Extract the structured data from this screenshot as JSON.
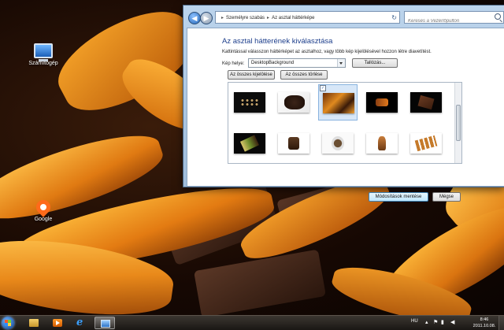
{
  "desktop": {
    "icons": [
      {
        "label": "Számítógép",
        "icon": "computer-icon"
      },
      {
        "label": "Google",
        "icon": "map-pin-icon"
      }
    ]
  },
  "window": {
    "breadcrumb": [
      "Személyre szabás",
      "Az asztal háttérképe"
    ],
    "search_placeholder": "Keresés a Vezérlőpulton",
    "title": "Az asztal hátterének kiválasztása",
    "description": "Kattintással válasszon háttérképet az asztalhoz, vagy több kép kijelölésével hozzon létre diavetítést.",
    "location_label": "Kép helye:",
    "location_value": "DesktopBackground",
    "browse_label": "Tallózás...",
    "select_all_label": "Az összes kijelölése",
    "clear_all_label": "Az összes törlése",
    "thumbnails": [
      {
        "name": "wallpaper-1",
        "selected": false
      },
      {
        "name": "wallpaper-2",
        "selected": false
      },
      {
        "name": "wallpaper-3",
        "selected": true
      },
      {
        "name": "wallpaper-4",
        "selected": false
      },
      {
        "name": "wallpaper-5",
        "selected": false
      },
      {
        "name": "wallpaper-6",
        "selected": false
      },
      {
        "name": "wallpaper-7",
        "selected": false
      },
      {
        "name": "wallpaper-8",
        "selected": false
      },
      {
        "name": "wallpaper-9",
        "selected": false
      },
      {
        "name": "wallpaper-10",
        "selected": false
      }
    ],
    "check_mark": "✓",
    "save_label": "Módosítások mentése",
    "cancel_label": "Mégse"
  },
  "taskbar": {
    "apps": [
      {
        "name": "explorer",
        "icon": "folder-icon",
        "active": false
      },
      {
        "name": "media",
        "icon": "media-player-icon",
        "active": false
      },
      {
        "name": "internet-explorer",
        "icon": "internet-explorer-icon",
        "active": false
      },
      {
        "name": "control-panel",
        "icon": "control-panel-icon",
        "active": true
      }
    ],
    "language": "HU",
    "time": "8:46",
    "date": "2011.10.08."
  },
  "colors": {
    "title_blue": "#1e3f8c",
    "selection": "#d7e7f8",
    "accent_orange": "#e07d13"
  }
}
